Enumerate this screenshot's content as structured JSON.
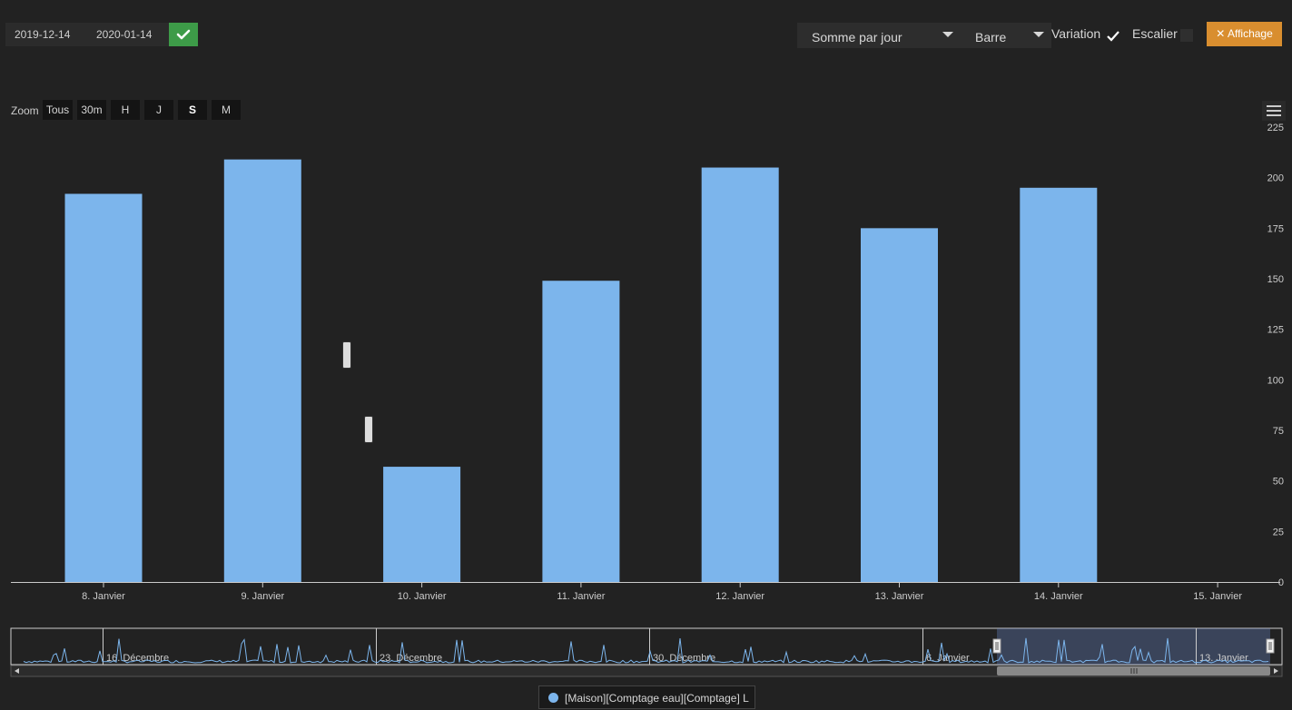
{
  "toolbar": {
    "start_date": "2019-12-14",
    "end_date": "2020-01-14",
    "aggregation_select": "Somme par jour",
    "chart_type_select": "Barre",
    "variation_label": "Variation",
    "variation_checked": true,
    "escalier_label": "Escalier",
    "escalier_checked": false,
    "affichage_label": "Affichage"
  },
  "zoom": {
    "label": "Zoom",
    "buttons": [
      "Tous",
      "30m",
      "H",
      "J",
      "S",
      "M"
    ],
    "active": "S"
  },
  "colors": {
    "series": "#7cb5ec",
    "background": "#222222",
    "confirm": "#3d9b48",
    "affichage": "#d98e2f"
  },
  "chart_data": {
    "type": "bar",
    "categories": [
      "8. Janvier",
      "9. Janvier",
      "10. Janvier",
      "11. Janvier",
      "12. Janvier",
      "13. Janvier",
      "14. Janvier",
      "15. Janvier"
    ],
    "series": [
      {
        "name": "[Maison][Comptage eau][Comptage] L",
        "values": [
          192,
          209,
          57,
          149,
          205,
          175,
          195,
          null
        ]
      }
    ],
    "yticks": [
      0,
      25,
      50,
      75,
      100,
      125,
      150,
      175,
      200,
      225
    ],
    "ylim": [
      0,
      225
    ],
    "y_axis_position": "right",
    "legend_position": "bottom-center",
    "navigator": {
      "labels": [
        "16. Décembre",
        "23. Décembre",
        "30. Décembre",
        "6. Janvier",
        "13. Janvier"
      ]
    }
  }
}
